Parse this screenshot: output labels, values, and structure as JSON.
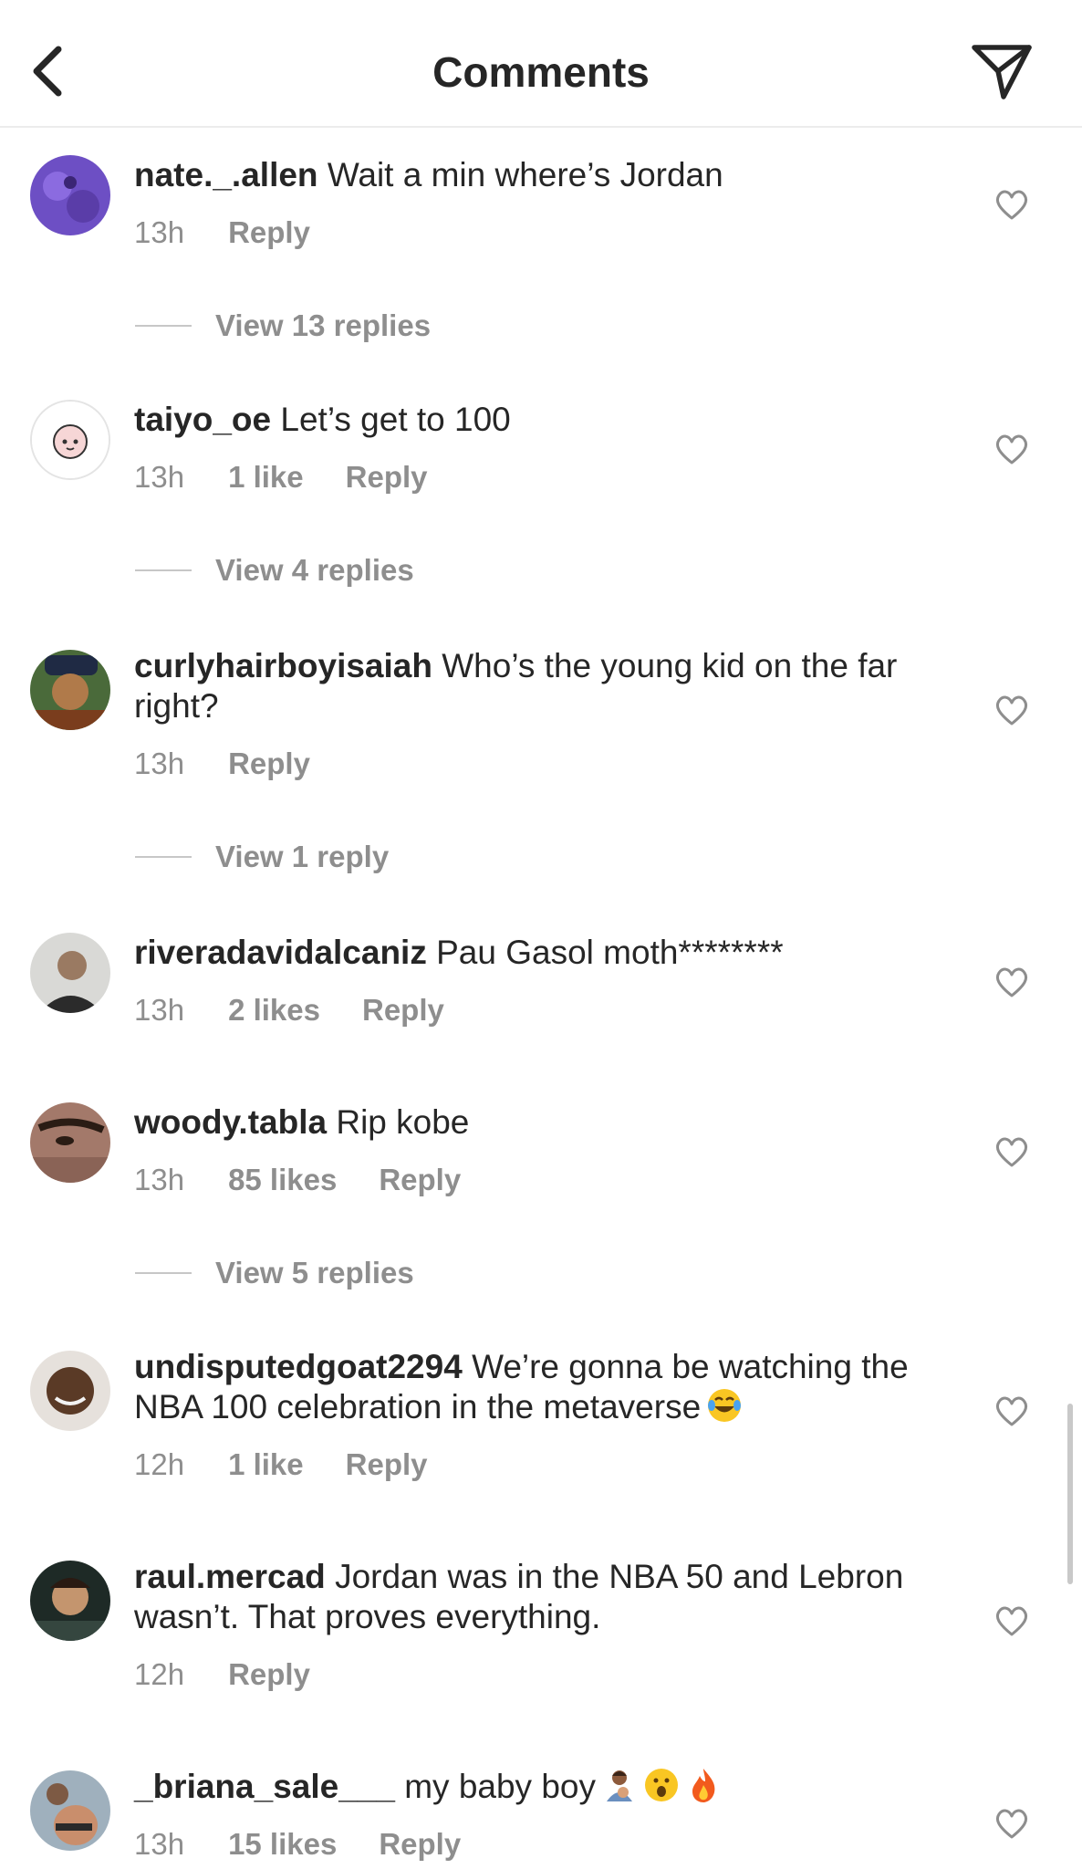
{
  "header": {
    "title": "Comments",
    "back_icon": "chevron-left-icon",
    "send_icon": "paper-plane-icon"
  },
  "comments": [
    {
      "username": "nate._.allen",
      "text": "Wait a min where’s Jordan",
      "time": "13h",
      "reply": "Reply",
      "view_replies": "View 13 replies"
    },
    {
      "username": "taiyo_oe",
      "text": "Let’s get to 100",
      "time": "13h",
      "likes": "1 like",
      "reply": "Reply",
      "view_replies": "View 4 replies"
    },
    {
      "username": "curlyhairboyisaiah",
      "text": "Who’s the young kid on the far right?",
      "time": "13h",
      "reply": "Reply",
      "view_replies": "View 1 reply"
    },
    {
      "username": "riveradavidalcaniz",
      "text": "Pau Gasol moth********",
      "time": "13h",
      "likes": "2 likes",
      "reply": "Reply"
    },
    {
      "username": "woody.tabla",
      "text": "Rip kobe",
      "time": "13h",
      "likes": "85 likes",
      "reply": "Reply",
      "view_replies": "View 5 replies"
    },
    {
      "username": "undisputedgoat2294",
      "text": "We’re gonna be watching the NBA 100 celebration in the metaverse",
      "emoji": [
        "tears-of-joy-emoji"
      ],
      "time": "12h",
      "likes": "1 like",
      "reply": "Reply"
    },
    {
      "username": "raul.mercad",
      "text": "Jordan was in the NBA 50 and Lebron wasn’t. That proves everything.",
      "time": "12h",
      "reply": "Reply"
    },
    {
      "username": "_briana_sale___",
      "text": "my baby boy",
      "emoji": [
        "mother-baby-emoji",
        "surprised-face-emoji",
        "fire-emoji"
      ],
      "time": "13h",
      "likes": "15 likes",
      "reply": "Reply"
    }
  ],
  "colors": {
    "primary_text": "#262626",
    "secondary_text": "#8e8e8e",
    "divider": "#ececec"
  }
}
